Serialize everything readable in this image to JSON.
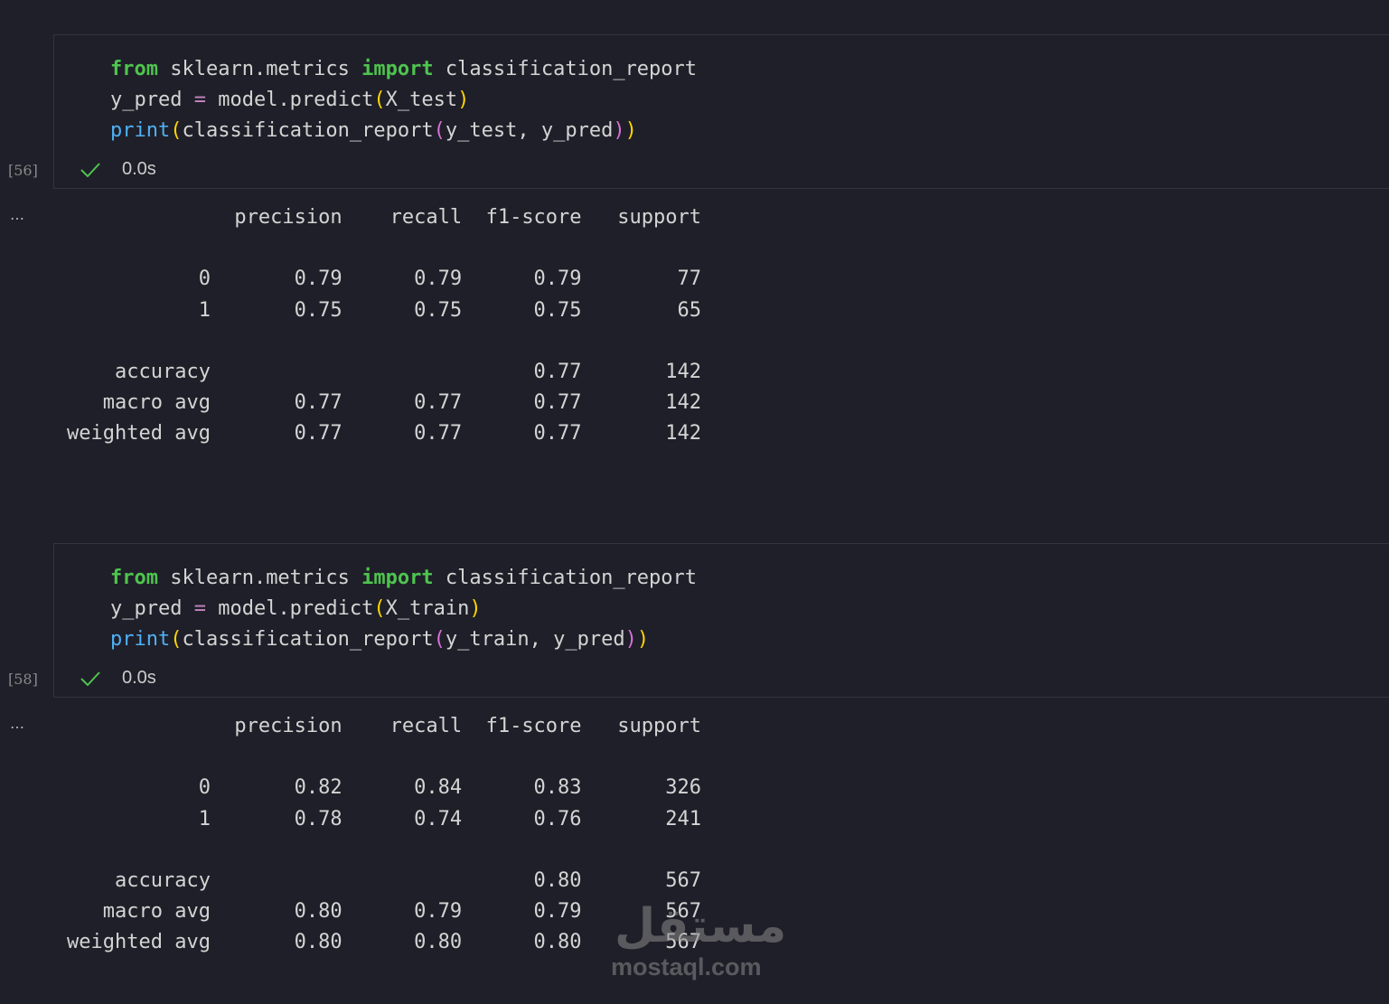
{
  "cells": [
    {
      "execution_count": "[56]",
      "status": "0.0s",
      "output_menu": "…",
      "code": [
        [
          {
            "t": "kw",
            "v": "from"
          },
          {
            "t": "txt",
            "v": " sklearn.metrics "
          },
          {
            "t": "kw",
            "v": "import"
          },
          {
            "t": "txt",
            "v": " classification_report"
          }
        ],
        [
          {
            "t": "txt",
            "v": "y_pred "
          },
          {
            "t": "op",
            "v": "="
          },
          {
            "t": "txt",
            "v": " model.predict"
          },
          {
            "t": "p1",
            "v": "("
          },
          {
            "t": "txt",
            "v": "X_test"
          },
          {
            "t": "p1",
            "v": ")"
          }
        ],
        [
          {
            "t": "fn",
            "v": "print"
          },
          {
            "t": "p1",
            "v": "("
          },
          {
            "t": "txt",
            "v": "classification_report"
          },
          {
            "t": "p2",
            "v": "("
          },
          {
            "t": "txt",
            "v": "y_test, y_pred"
          },
          {
            "t": "p2",
            "v": ")"
          },
          {
            "t": "p1",
            "v": ")"
          }
        ]
      ],
      "output": "              precision    recall  f1-score   support\n\n           0       0.79      0.79      0.79        77\n           1       0.75      0.75      0.75        65\n\n    accuracy                           0.77       142\n   macro avg       0.77      0.77      0.77       142\nweighted avg       0.77      0.77      0.77       142"
    },
    {
      "execution_count": "[58]",
      "status": "0.0s",
      "output_menu": "…",
      "code": [
        [
          {
            "t": "kw",
            "v": "from"
          },
          {
            "t": "txt",
            "v": " sklearn.metrics "
          },
          {
            "t": "kw",
            "v": "import"
          },
          {
            "t": "txt",
            "v": " classification_report"
          }
        ],
        [
          {
            "t": "txt",
            "v": "y_pred "
          },
          {
            "t": "op",
            "v": "="
          },
          {
            "t": "txt",
            "v": " model.predict"
          },
          {
            "t": "p1",
            "v": "("
          },
          {
            "t": "txt",
            "v": "X_train"
          },
          {
            "t": "p1",
            "v": ")"
          }
        ],
        [
          {
            "t": "fn",
            "v": "print"
          },
          {
            "t": "p1",
            "v": "("
          },
          {
            "t": "txt",
            "v": "classification_report"
          },
          {
            "t": "p2",
            "v": "("
          },
          {
            "t": "txt",
            "v": "y_train, y_pred"
          },
          {
            "t": "p2",
            "v": ")"
          },
          {
            "t": "p1",
            "v": ")"
          }
        ]
      ],
      "output": "              precision    recall  f1-score   support\n\n           0       0.82      0.84      0.83       326\n           1       0.78      0.74      0.76       241\n\n    accuracy                           0.80       567\n   macro avg       0.80      0.79      0.79       567\nweighted avg       0.80      0.80      0.80       567"
    }
  ],
  "watermark": {
    "arabic": "مستقل",
    "latin": "mostaql.com"
  },
  "colors": {
    "background": "#1f1f29",
    "keyword": "#4ec44e",
    "builtin": "#4fb1f5",
    "operator": "#c586c0",
    "bracket_level1": "#ffd700",
    "bracket_level2": "#da70d6",
    "success_check": "#4ec44e"
  }
}
